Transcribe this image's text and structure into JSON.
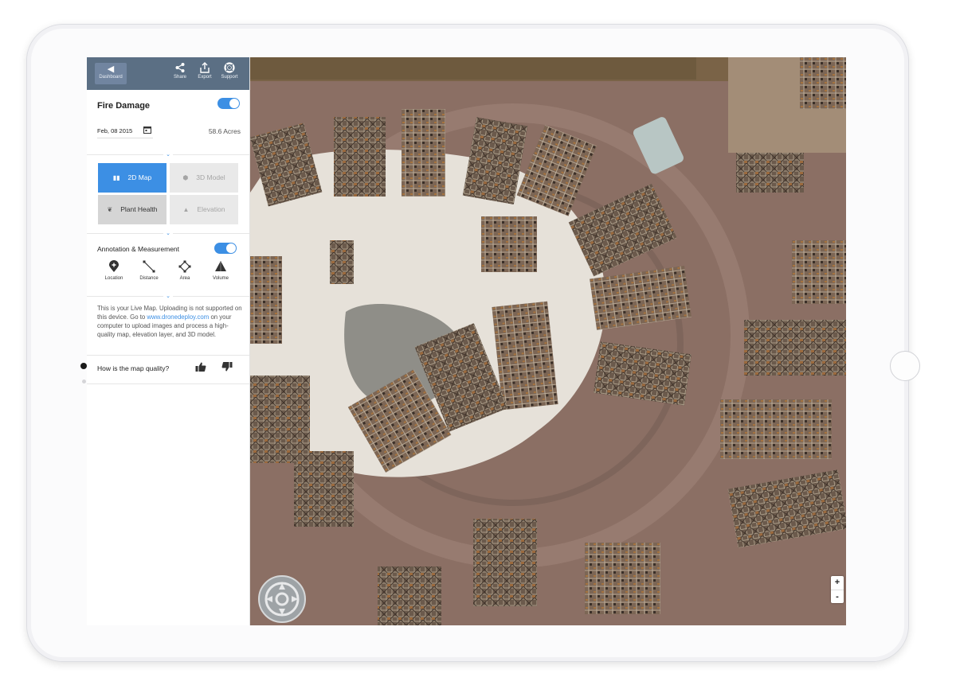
{
  "topbar": {
    "dashboard_label": "Dashboard",
    "share_label": "Share",
    "export_label": "Export",
    "support_label": "Support"
  },
  "map_info": {
    "title": "Fire Damage",
    "toggle_on": true,
    "date": "Feb, 08 2015",
    "acres": "58.6 Acres"
  },
  "views": [
    {
      "label": "2D Map",
      "icon": "map-icon",
      "state": "active"
    },
    {
      "label": "3D Model",
      "icon": "cube-icon",
      "state": "disabled"
    },
    {
      "label": "Plant Health",
      "icon": "leaf-icon",
      "state": "enabled"
    },
    {
      "label": "Elevation",
      "icon": "mountain-icon",
      "state": "disabled"
    }
  ],
  "annotation": {
    "title": "Annotation & Measurement",
    "toggle_on": true,
    "tools": [
      {
        "label": "Location",
        "icon": "location-pin-icon"
      },
      {
        "label": "Distance",
        "icon": "distance-line-icon"
      },
      {
        "label": "Area",
        "icon": "area-polygon-icon"
      },
      {
        "label": "Volume",
        "icon": "volume-cone-icon"
      }
    ]
  },
  "live_map": {
    "text_before": "This is your Live Map. Uploading is not supported on this device. Go to ",
    "link": "www.dronedeploy.com",
    "text_after": " on your computer to upload images and process a high-quality map, elevation layer, and 3D model."
  },
  "feedback": {
    "question": "How is the map quality?"
  },
  "map_controls": {
    "zoom_in": "+",
    "zoom_out": "-"
  },
  "colors": {
    "accent": "#3c8fe4",
    "topbar": "#5b6f84"
  }
}
